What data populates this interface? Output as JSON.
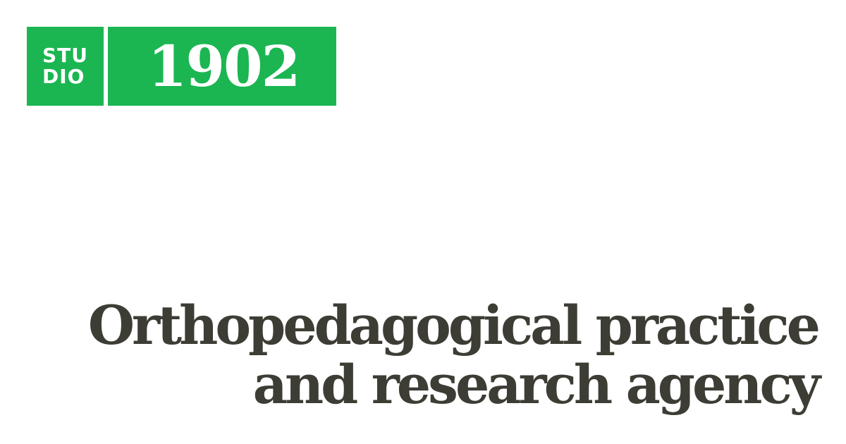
{
  "logo": {
    "line1": "STU",
    "line2": "DIO",
    "number": "1902",
    "brand_color": "#1bb652"
  },
  "headline": {
    "line1": "Orthopedagogical practice",
    "line2": "and research agency",
    "color": "#3d3d35"
  }
}
